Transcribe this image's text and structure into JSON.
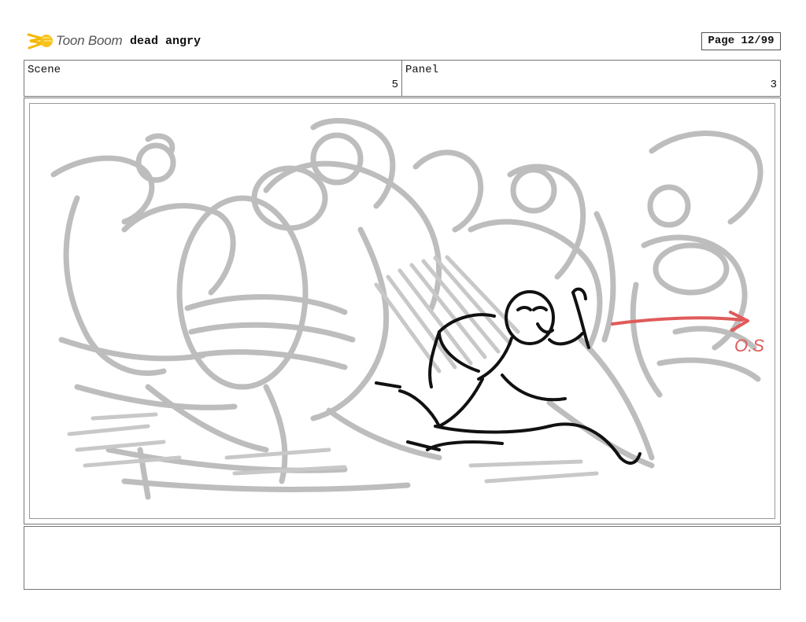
{
  "header": {
    "logo_text": "Toon Boom",
    "project_title": "dead angry",
    "page_label": "Page 12/99"
  },
  "scene": {
    "label": "Scene",
    "value": "5"
  },
  "panel": {
    "label": "Panel",
    "value": "3"
  },
  "drawing": {
    "annotation": "O.S",
    "colors": {
      "rough": "#bdbdbd",
      "ink": "#111111",
      "arrow": "#e05a5a"
    }
  },
  "notes": {
    "text": ""
  }
}
